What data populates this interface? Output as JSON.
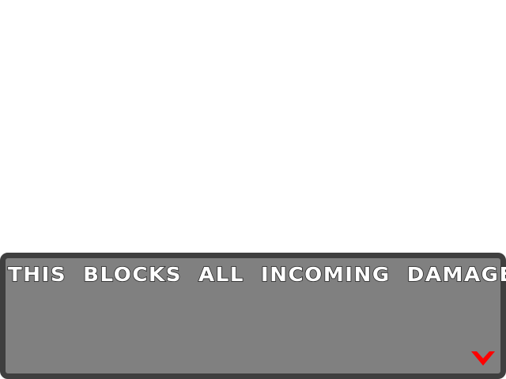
{
  "dialog": {
    "text": "THIS BLOCKS ALL INCOMING DAMAGE",
    "advance_icon": "chevron-down-icon"
  },
  "colors": {
    "background": "#ffffff",
    "box_fill": "#808080",
    "box_border": "#3f3f3f",
    "text": "#ffffff",
    "text_outline": "#222222",
    "advance_arrow": "#ff0000"
  }
}
